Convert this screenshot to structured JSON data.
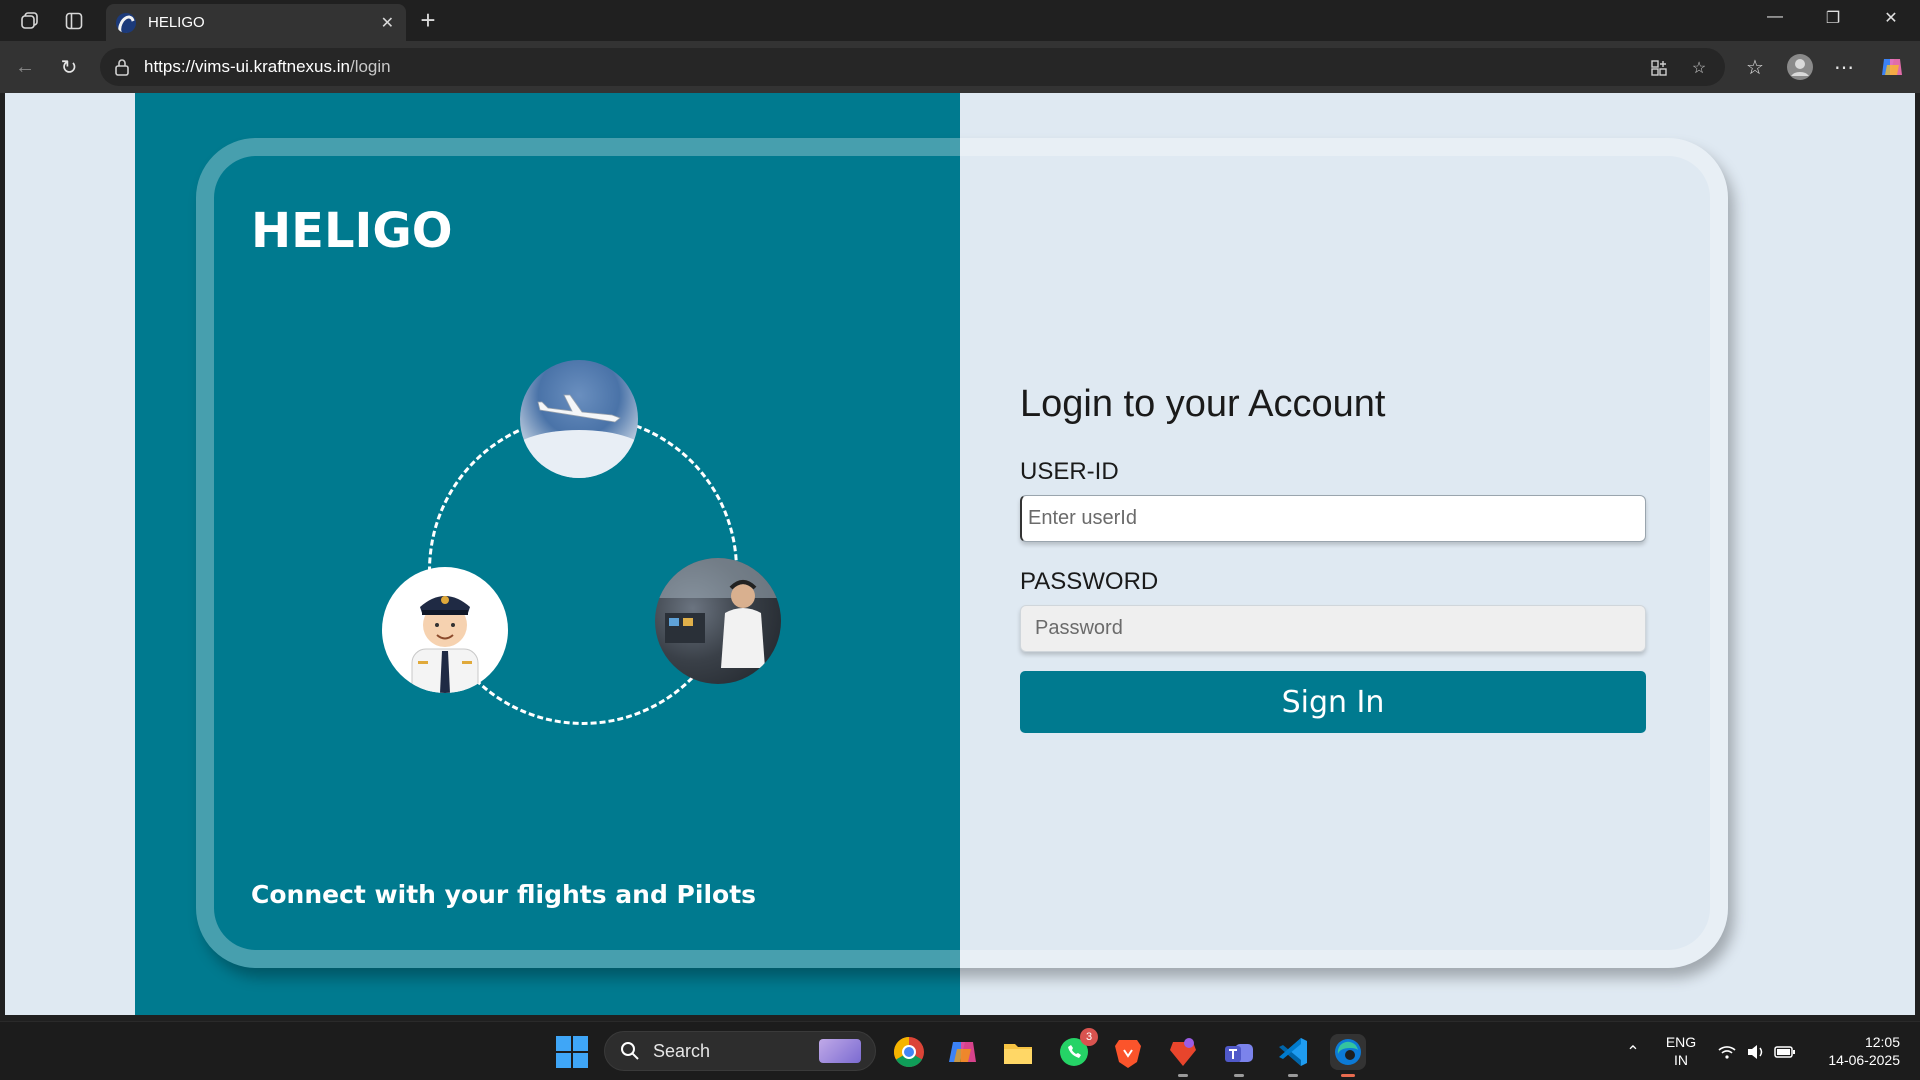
{
  "browser": {
    "tab_title": "HELIGO",
    "url_host": "https://vims-ui.kraftnexus.in",
    "url_path": "/login"
  },
  "page": {
    "brand": "HELIGO",
    "tagline": "Connect with your flights and Pilots",
    "login_title": "Login to your Account",
    "user_label": "USER-ID",
    "user_placeholder": "Enter userId",
    "password_label": "PASSWORD",
    "password_placeholder": "Password",
    "signin_label": "Sign In"
  },
  "colors": {
    "accent": "#007a8f",
    "background": "#dfe9f2"
  },
  "taskbar": {
    "search_label": "Search",
    "whatsapp_badge": "3",
    "lang_top": "ENG",
    "lang_bottom": "IN",
    "time": "12:05",
    "date": "14-06-2025"
  }
}
